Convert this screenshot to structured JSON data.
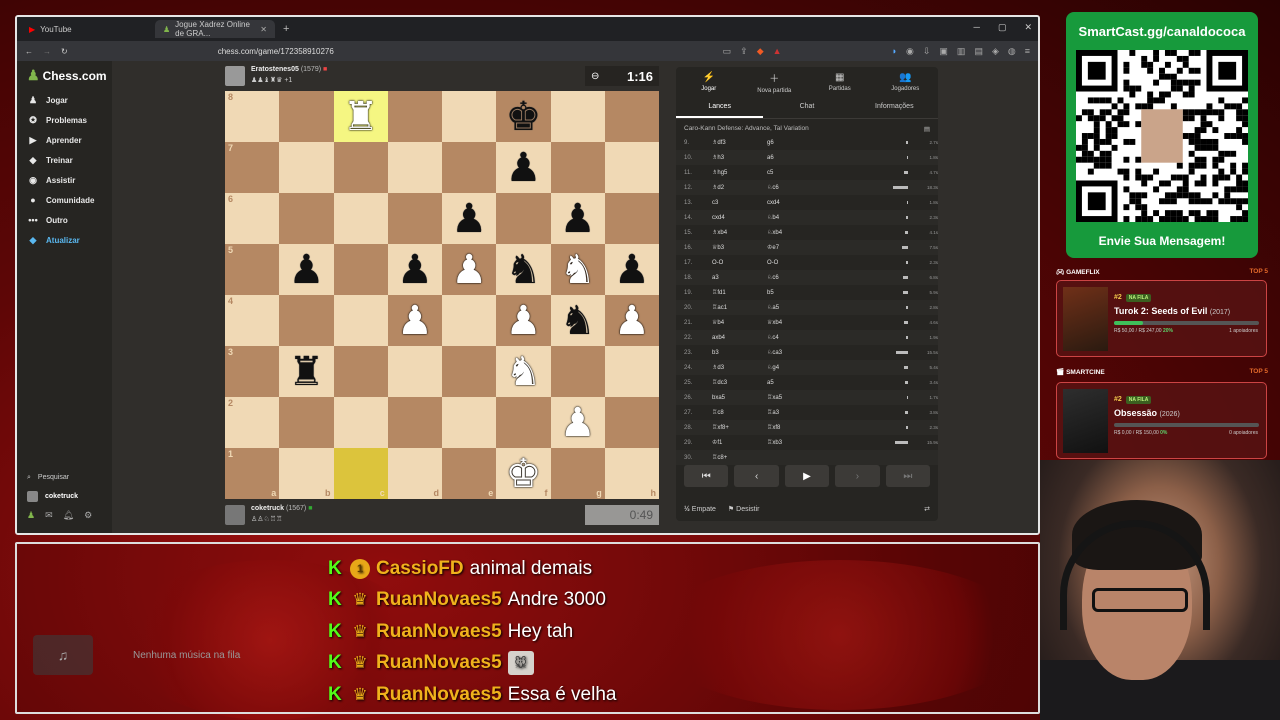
{
  "browser": {
    "tabs": [
      {
        "label": "YouTube",
        "active": false
      },
      {
        "label": "Jogue Xadrez Online de GRA...",
        "active": true
      }
    ],
    "url": "chess.com/game/172358910276"
  },
  "sidebar": {
    "logo": "Chess.com",
    "items": [
      {
        "label": "Jogar",
        "icon": "♟"
      },
      {
        "label": "Problemas",
        "icon": "✪"
      },
      {
        "label": "Aprender",
        "icon": "▶"
      },
      {
        "label": "Treinar",
        "icon": "◆"
      },
      {
        "label": "Assistir",
        "icon": "◉"
      },
      {
        "label": "Comunidade",
        "icon": "●"
      },
      {
        "label": "Outro",
        "icon": "•••"
      },
      {
        "label": "Atualizar",
        "icon": "◆"
      }
    ],
    "search": "Pesquisar",
    "user": "coketruck",
    "notif_count": "1"
  },
  "game": {
    "top_player": {
      "name": "Eratostenes05",
      "rating": "(1579)",
      "sub": "+1"
    },
    "bottom_player": {
      "name": "coketruck",
      "rating": "(1567)"
    },
    "top_clock": "1:16",
    "bottom_clock": "0:49",
    "files": [
      "a",
      "b",
      "c",
      "d",
      "e",
      "f",
      "g",
      "h"
    ],
    "ranks": [
      "8",
      "7",
      "6",
      "5",
      "4",
      "3",
      "2",
      "1"
    ],
    "board": [
      [
        "",
        "",
        "wR",
        "",
        "",
        "bK",
        "",
        ""
      ],
      [
        "",
        "",
        "",
        "",
        "",
        "bP",
        "",
        ""
      ],
      [
        "",
        "",
        "",
        "",
        "bP",
        "",
        "bP",
        ""
      ],
      [
        "",
        "bP",
        "",
        "bP",
        "wP",
        "bN",
        "wN",
        "bP"
      ],
      [
        "",
        "",
        "",
        "wP",
        "",
        "wP",
        "bN",
        "wP"
      ],
      [
        "",
        "bR",
        "",
        "",
        "",
        "wN",
        "",
        ""
      ],
      [
        "",
        "",
        "",
        "",
        "",
        "",
        "wP",
        ""
      ],
      [
        "",
        "",
        "",
        "",
        "",
        "wK",
        "",
        ""
      ]
    ],
    "highlight": [
      "c8",
      "c1"
    ]
  },
  "panel": {
    "tabs": [
      {
        "label": "Jogar",
        "icon": "⚡"
      },
      {
        "label": "Nova partida",
        "icon": "＋"
      },
      {
        "label": "Partidas",
        "icon": "▦"
      },
      {
        "label": "Jogadores",
        "icon": "👥"
      }
    ],
    "subtabs": [
      "Lances",
      "Chat",
      "Informações"
    ],
    "opening": "Caro-Kann Defense: Advance, Tal Variation",
    "moves": [
      {
        "n": "9.",
        "w": "♗df3",
        "b": "g6",
        "t": "2.7s"
      },
      {
        "n": "10.",
        "w": "♗h3",
        "b": "a6",
        "t": "1.8s"
      },
      {
        "n": "11.",
        "w": "♗hg5",
        "b": "c5",
        "t": "4.7s"
      },
      {
        "n": "12.",
        "w": "♗d2",
        "b": "♘c6",
        "t": "18.3s"
      },
      {
        "n": "13.",
        "w": "c3",
        "b": "cxd4",
        "t": "1.8s"
      },
      {
        "n": "14.",
        "w": "cxd4",
        "b": "♘b4",
        "t": "2.3s"
      },
      {
        "n": "15.",
        "w": "♗xb4",
        "b": "♘xb4",
        "t": "4.1s"
      },
      {
        "n": "16.",
        "w": "♕b3",
        "b": "♔e7",
        "t": "7.5s"
      },
      {
        "n": "17.",
        "w": "O-O",
        "b": "O-O",
        "t": "2.3s"
      },
      {
        "n": "18.",
        "w": "a3",
        "b": "♘c6",
        "t": "6.8s"
      },
      {
        "n": "19.",
        "w": "♖fd1",
        "b": "b5",
        "t": "5.9s"
      },
      {
        "n": "20.",
        "w": "♖ac1",
        "b": "♘a5",
        "t": "2.8s"
      },
      {
        "n": "21.",
        "w": "♕b4",
        "b": "♕xb4",
        "t": "4.6s"
      },
      {
        "n": "22.",
        "w": "axb4",
        "b": "♘c4",
        "t": "1.9s"
      },
      {
        "n": "23.",
        "w": "b3",
        "b": "♘ca3",
        "t": "15.5s"
      },
      {
        "n": "24.",
        "w": "♗d3",
        "b": "♘g4",
        "t": "5.4s"
      },
      {
        "n": "25.",
        "w": "♖dc3",
        "b": "a5",
        "t": "3.4s"
      },
      {
        "n": "26.",
        "w": "bxa5",
        "b": "♖xa5",
        "t": "1.7s"
      },
      {
        "n": "27.",
        "w": "♖c8",
        "b": "♖a3",
        "t": "3.8s"
      },
      {
        "n": "28.",
        "w": "♖xf8+",
        "b": "♖xf8",
        "t": "2.3s"
      },
      {
        "n": "29.",
        "w": "♔f1",
        "b": "♖xb3",
        "t": "15.9s"
      },
      {
        "n": "30.",
        "w": "♖c8+",
        "b": "",
        "t": ""
      }
    ],
    "draw": "Empate",
    "resign": "Desistir"
  },
  "stream": {
    "music": "Nenhuma música na fila",
    "chat": [
      {
        "badge": "1",
        "user": "CassioFD",
        "msg": "animal demais"
      },
      {
        "badge": "crown",
        "user": "RuanNovaes5",
        "msg": "Andre 3000"
      },
      {
        "badge": "crown",
        "user": "RuanNovaes5",
        "msg": "Hey tah"
      },
      {
        "badge": "crown",
        "user": "RuanNovaes5",
        "msg": ""
      },
      {
        "badge": "crown",
        "user": "RuanNovaes5",
        "msg": "Essa é velha"
      }
    ],
    "qr_title": "SmartCast.gg/canaldococa",
    "qr_footer": "Envie Sua Mensagem!",
    "gameflix": {
      "label": "GAMEFLIX",
      "top": "TOP 5",
      "rank": "#2",
      "status": "NA FILA",
      "title": "Turok 2: Seeds of Evil",
      "year": "(2017)",
      "price": "R$ 50,00 / R$ 247,00",
      "pct": "20%",
      "progress": 0.2,
      "supporters": "1 apoiadores"
    },
    "smartcine": {
      "label": "SMARTCINE",
      "top": "TOP 5",
      "rank": "#2",
      "status": "NA FILA",
      "title": "Obsessão",
      "year": "(2026)",
      "price": "R$ 0,00 / R$ 150,00",
      "pct": "0%",
      "progress": 0,
      "supporters": "0 apoiadores"
    }
  }
}
